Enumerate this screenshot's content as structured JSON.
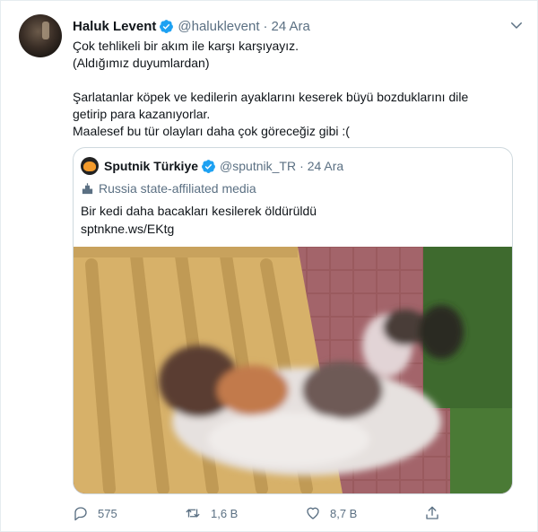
{
  "tweet": {
    "author_name": "Haluk Levent",
    "author_handle": "@haluklevent",
    "separator": "·",
    "date": "24 Ara",
    "lines": [
      "Çok tehlikeli bir akım ile karşı karşıyayız.",
      "(Aldığımız duyumlardan)",
      "",
      "Şarlatanlar köpek ve kedilerin ayaklarını keserek büyü bozduklarını dile",
      "getirip para kazanıyorlar.",
      "Maalesef bu tür olayları daha çok göreceğiz gibi :("
    ]
  },
  "quote": {
    "author_name": "Sputnik Türkiye",
    "author_handle": "@sputnik_TR",
    "separator": "·",
    "date": "24 Ara",
    "label": "Russia state-affiliated media",
    "text": "Bir kedi daha bacakları kesilerek öldürüldü",
    "link": "sptnkne.ws/EKtg"
  },
  "actions": {
    "replies": "575",
    "retweets": "1,6 B",
    "likes": "8,7 B"
  },
  "colors": {
    "verified": "#1da1f2",
    "secondary_text": "#5b7083",
    "border": "#cfd9de"
  },
  "icons": [
    "chevron-down-icon",
    "verified-badge-icon",
    "podium-icon",
    "reply-icon",
    "retweet-icon",
    "like-icon",
    "share-icon"
  ]
}
